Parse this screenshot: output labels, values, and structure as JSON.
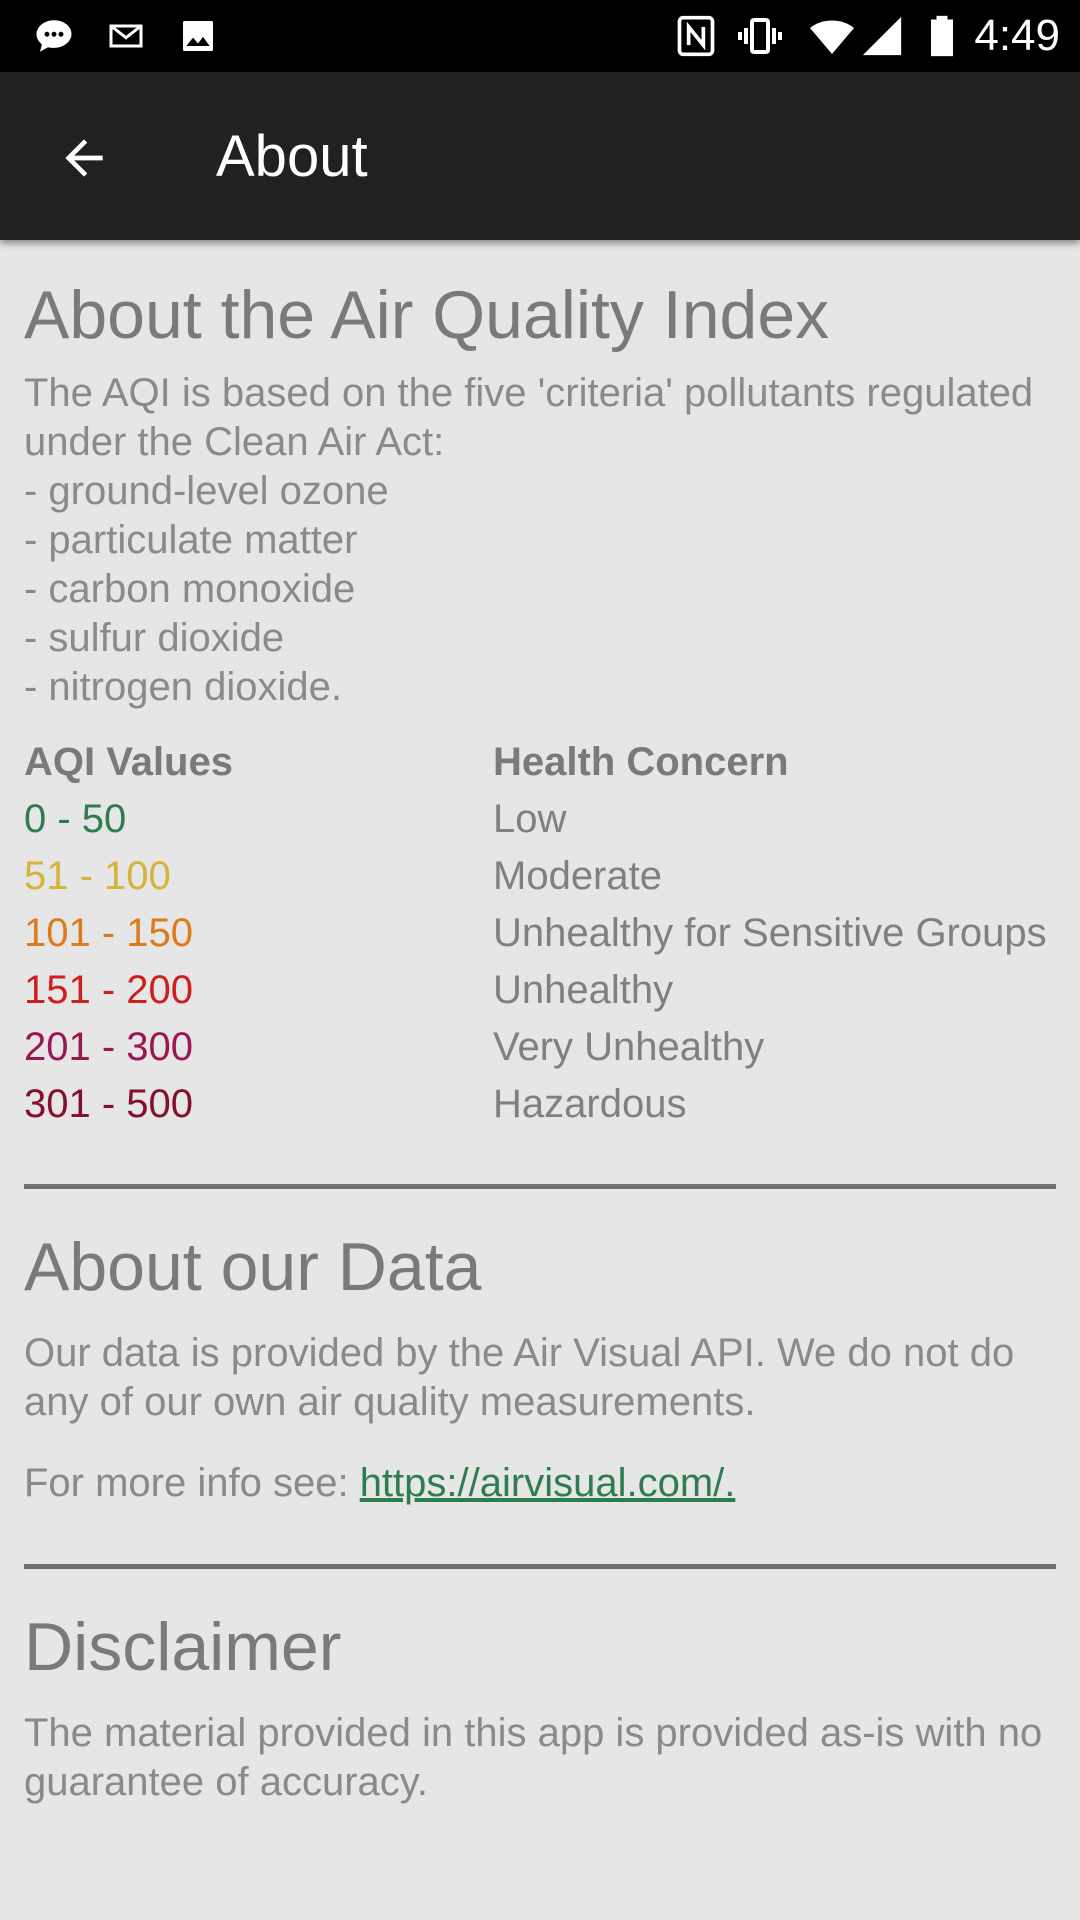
{
  "status_bar": {
    "time": "4:49",
    "icons_left": [
      "chat-bubble-icon",
      "mail-icon",
      "image-icon"
    ],
    "icons_right": [
      "nfc-icon",
      "vibrate-icon",
      "wifi-icon",
      "signal-icon",
      "battery-icon"
    ]
  },
  "app_bar": {
    "title": "About",
    "back_icon": "arrow-left-icon"
  },
  "aqi_section": {
    "title": "About the Air Quality Index",
    "intro": "The AQI is based on the five 'criteria' pollutants regulated under the Clean Air Act:",
    "pollutants": [
      "- ground-level ozone",
      "- particulate matter",
      "- carbon monoxide",
      "- sulfur dioxide",
      "- nitrogen dioxide."
    ],
    "table": {
      "headers": [
        "AQI Values",
        "Health Concern"
      ],
      "rows": [
        {
          "range": "0 - 50",
          "concern": "Low",
          "color": "#2e7d4f"
        },
        {
          "range": "51 - 100",
          "concern": "Moderate",
          "color": "#d4b43a"
        },
        {
          "range": "101 - 150",
          "concern": "Unhealthy for Sensitive Groups",
          "color": "#dd7a1c"
        },
        {
          "range": "151 - 200",
          "concern": "Unhealthy",
          "color": "#cc1f1f"
        },
        {
          "range": "201 - 300",
          "concern": "Very Unhealthy",
          "color": "#9c1652"
        },
        {
          "range": "301 - 500",
          "concern": "Hazardous",
          "color": "#84102f"
        }
      ]
    }
  },
  "data_section": {
    "title": "About our Data",
    "body": "Our data is provided by the Air Visual API. We do not do any of our own air quality measurements.",
    "more_info_prefix": "For more info see: ",
    "link_text": "https://airvisual.com/."
  },
  "disclaimer_section": {
    "title": "Disclaimer",
    "body": "The material provided in this app is provided as-is with no guarantee of accuracy."
  }
}
